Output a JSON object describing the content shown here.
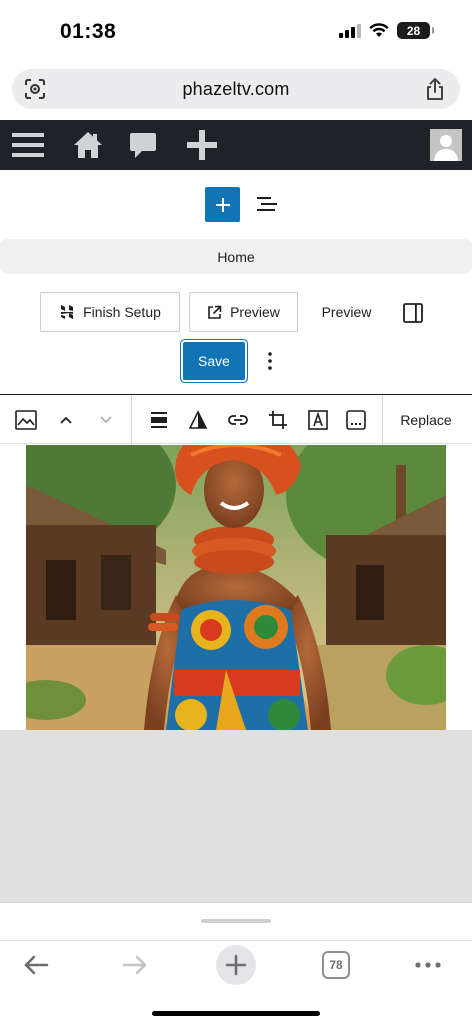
{
  "status_bar": {
    "time": "01:38",
    "battery": "28"
  },
  "browser": {
    "url": "phazeltv.com",
    "tabs_count": "78"
  },
  "editor": {
    "document_title": "Home",
    "finish_setup_label": "Finish Setup",
    "preview_external_label": "Preview",
    "preview_label": "Preview",
    "save_label": "Save"
  },
  "block_toolbar": {
    "replace_label": "Replace"
  },
  "colors": {
    "wp_blue": "#1074b5",
    "admin_bar": "#1d2327",
    "canvas_gray": "#e0e0e0"
  }
}
